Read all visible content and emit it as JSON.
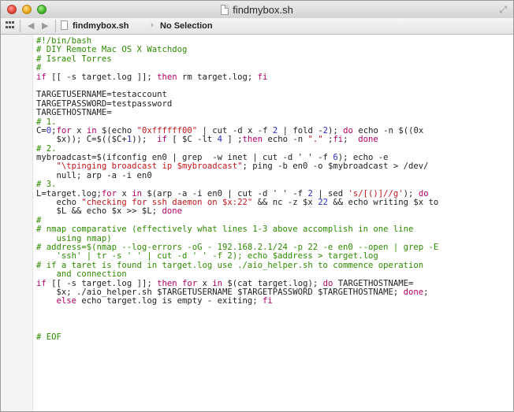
{
  "window": {
    "title": "findmybox.sh"
  },
  "jumpbar": {
    "file": "findmybox.sh",
    "selection": "No Selection"
  },
  "code_lines": [
    [
      [
        "cm",
        "#!/bin/bash"
      ]
    ],
    [
      [
        "cm",
        "# DIY Remote Mac OS X Watchdog"
      ]
    ],
    [
      [
        "cm",
        "# Israel Torres"
      ]
    ],
    [
      [
        "cm",
        "#"
      ]
    ],
    [
      [
        "kw",
        "if"
      ],
      [
        "tx",
        " [[ -s target.log ]]; "
      ],
      [
        "kw",
        "then"
      ],
      [
        "tx",
        " rm target.log; "
      ],
      [
        "kw",
        "fi"
      ]
    ],
    [
      [
        "tx",
        " "
      ]
    ],
    [
      [
        "tx",
        "TARGETUSERNAME=testaccount"
      ]
    ],
    [
      [
        "tx",
        "TARGETPASSWORD=testpassword"
      ]
    ],
    [
      [
        "tx",
        "TARGETHOSTNAME="
      ]
    ],
    [
      [
        "cm",
        "# 1."
      ]
    ],
    [
      [
        "tx",
        "C="
      ],
      [
        "nu",
        "0"
      ],
      [
        "tx",
        ";"
      ],
      [
        "kw",
        "for"
      ],
      [
        "tx",
        " x "
      ],
      [
        "kw",
        "in"
      ],
      [
        "tx",
        " $(echo "
      ],
      [
        "st",
        "\"0xffffff00\""
      ],
      [
        "tx",
        " | cut -d x -f "
      ],
      [
        "nu",
        "2"
      ],
      [
        "tx",
        " | fold -"
      ],
      [
        "nu",
        "2"
      ],
      [
        "tx",
        "); "
      ],
      [
        "kw",
        "do"
      ],
      [
        "tx",
        " echo -n $((0x"
      ]
    ],
    [
      [
        "tx",
        "    $x)); C=$(($C+"
      ],
      [
        "nu",
        "1"
      ],
      [
        "tx",
        "));  "
      ],
      [
        "kw",
        "if"
      ],
      [
        "tx",
        " [ $C -lt "
      ],
      [
        "nu",
        "4"
      ],
      [
        "tx",
        " ] ;"
      ],
      [
        "kw",
        "then"
      ],
      [
        "tx",
        " echo -n "
      ],
      [
        "st",
        "\".\""
      ],
      [
        "tx",
        " ;"
      ],
      [
        "kw",
        "fi"
      ],
      [
        "tx",
        ";  "
      ],
      [
        "kw",
        "done"
      ]
    ],
    [
      [
        "cm",
        "# 2."
      ]
    ],
    [
      [
        "tx",
        "mybroadcast=$(ifconfig en0 | grep  -w inet | cut -d ' ' -f "
      ],
      [
        "nu",
        "6"
      ],
      [
        "tx",
        "); echo -e"
      ]
    ],
    [
      [
        "tx",
        "    "
      ],
      [
        "st",
        "\"\\tpinging broadcast ip $mybroadcast\""
      ],
      [
        "tx",
        "; ping -b en0 -o $mybroadcast > /dev/"
      ]
    ],
    [
      [
        "tx",
        "    null; arp -a -i en0"
      ]
    ],
    [
      [
        "cm",
        "# 3."
      ]
    ],
    [
      [
        "tx",
        "L=target.log;"
      ],
      [
        "kw",
        "for"
      ],
      [
        "tx",
        " x "
      ],
      [
        "kw",
        "in"
      ],
      [
        "tx",
        " $(arp -a -i en0 | cut -d ' ' -f "
      ],
      [
        "nu",
        "2"
      ],
      [
        "tx",
        " | sed "
      ],
      [
        "st",
        "'s/[()]//g'"
      ],
      [
        "tx",
        "); "
      ],
      [
        "kw",
        "do"
      ]
    ],
    [
      [
        "tx",
        "    echo "
      ],
      [
        "st",
        "\"checking for ssh daemon on $x:22\""
      ],
      [
        "tx",
        " && nc -z $x "
      ],
      [
        "nu",
        "22"
      ],
      [
        "tx",
        " && echo writing $x to"
      ]
    ],
    [
      [
        "tx",
        "    $L && echo $x >> $L; "
      ],
      [
        "kw",
        "done"
      ]
    ],
    [
      [
        "cm",
        "#"
      ]
    ],
    [
      [
        "cm",
        "# nmap comparative (effectively what lines 1-3 above accomplish in one line"
      ]
    ],
    [
      [
        "cm",
        "    using nmap)"
      ]
    ],
    [
      [
        "cm",
        "# address=$(nmap --log-errors -oG - 192.168.2.1/24 -p 22 -e en0 --open | grep -E"
      ]
    ],
    [
      [
        "cm",
        "    'ssh' | tr -s ' ' | cut -d ' ' -f 2); echo $address > target.log"
      ]
    ],
    [
      [
        "cm",
        "# if a taret is found in target.log use ./aio_helper.sh to commence operation"
      ]
    ],
    [
      [
        "cm",
        "    and connection"
      ]
    ],
    [
      [
        "kw",
        "if"
      ],
      [
        "tx",
        " [[ -s target.log ]]; "
      ],
      [
        "kw",
        "then"
      ],
      [
        "tx",
        " "
      ],
      [
        "kw",
        "for"
      ],
      [
        "tx",
        " x "
      ],
      [
        "kw",
        "in"
      ],
      [
        "tx",
        " $(cat target.log); "
      ],
      [
        "kw",
        "do"
      ],
      [
        "tx",
        " TARGETHOSTNAME="
      ]
    ],
    [
      [
        "tx",
        "    $x; ./aio_helper.sh $TARGETUSERNAME $TARGETPASSWORD $TARGETHOSTNAME; "
      ],
      [
        "kw",
        "done"
      ],
      [
        "tx",
        ";"
      ]
    ],
    [
      [
        "tx",
        "    "
      ],
      [
        "kw",
        "else"
      ],
      [
        "tx",
        " echo target.log is empty - exiting; "
      ],
      [
        "kw",
        "fi"
      ]
    ],
    [
      [
        "tx",
        " "
      ]
    ],
    [
      [
        "tx",
        " "
      ]
    ],
    [
      [
        "tx",
        " "
      ]
    ],
    [
      [
        "cm",
        "# EOF"
      ]
    ]
  ]
}
